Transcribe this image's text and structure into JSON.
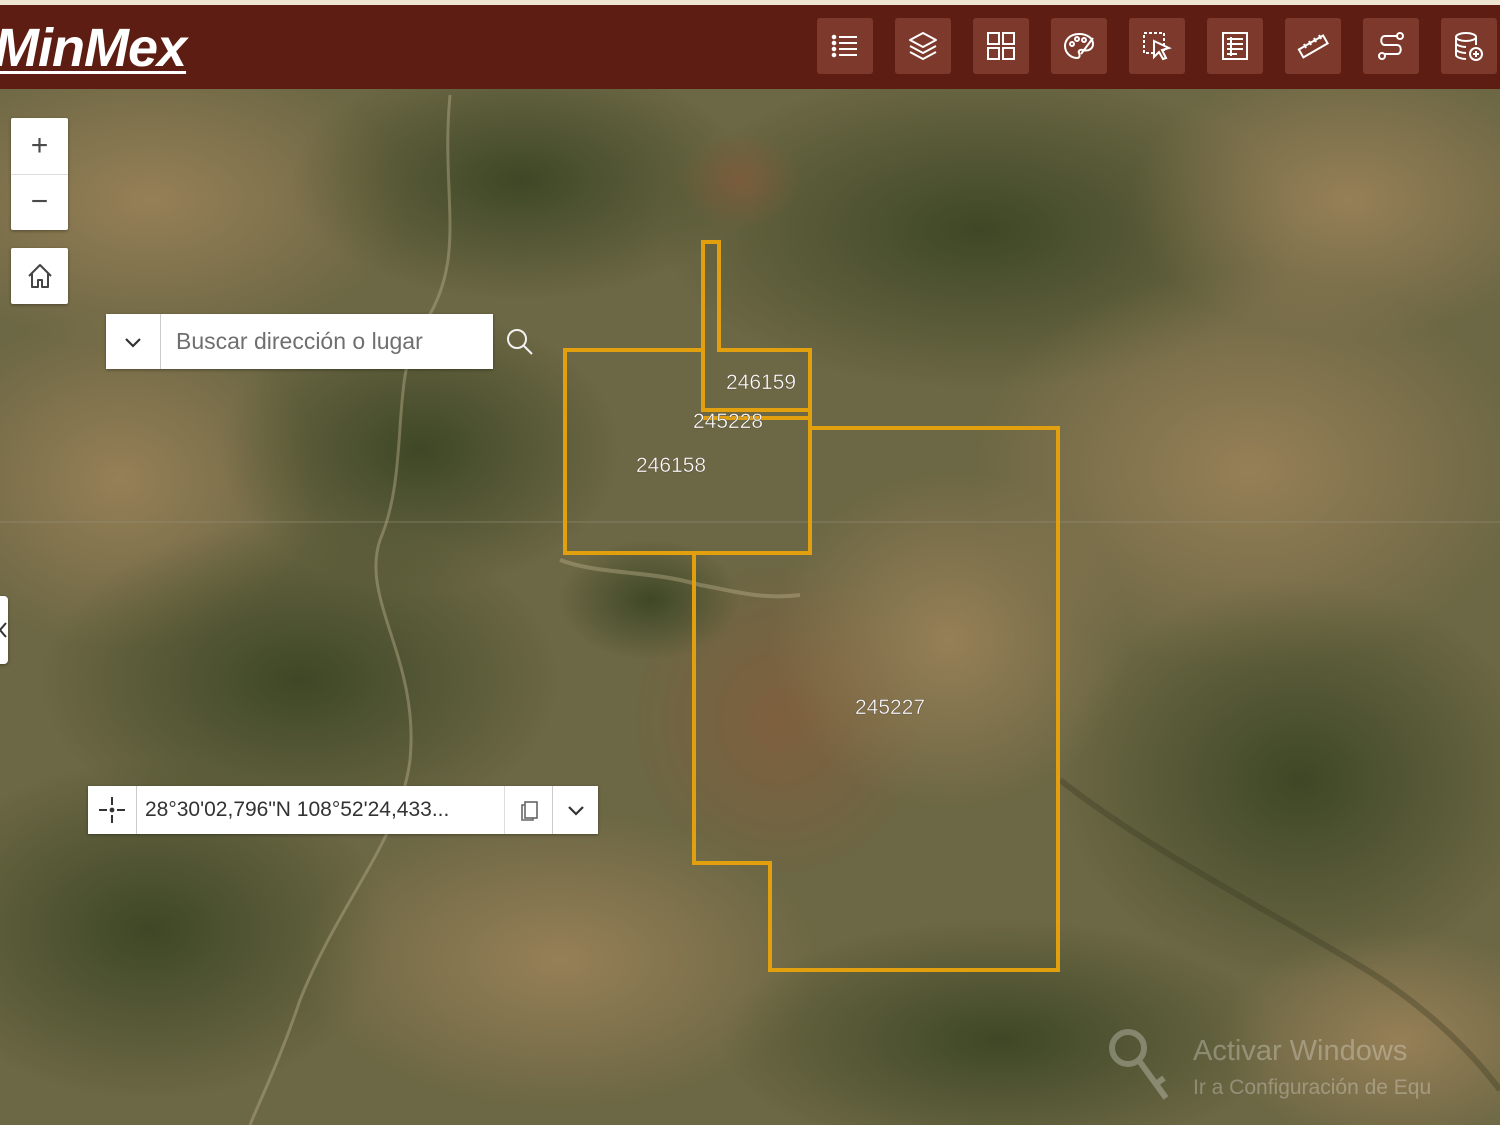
{
  "app": {
    "title": "MinMex"
  },
  "colors": {
    "header": "#5e1d12",
    "button": "#7d3a2c",
    "claim_outline": "#e2a00e"
  },
  "toolbar": [
    {
      "icon": "list-icon"
    },
    {
      "icon": "layers-icon"
    },
    {
      "icon": "grid-icon"
    },
    {
      "icon": "palette-icon"
    },
    {
      "icon": "select-icon"
    },
    {
      "icon": "table-icon"
    },
    {
      "icon": "measure-icon"
    },
    {
      "icon": "route-icon"
    },
    {
      "icon": "database-icon"
    }
  ],
  "zoom": {
    "in_label": "+",
    "out_label": "−"
  },
  "search": {
    "placeholder": "Buscar dirección o lugar"
  },
  "coordinates": {
    "value": "28°30'02,796\"N 108°52'24,433..."
  },
  "claims": [
    {
      "id": "246159"
    },
    {
      "id": "245228"
    },
    {
      "id": "246158"
    },
    {
      "id": "245227"
    }
  ],
  "watermark": {
    "title": "Activar Windows",
    "subtitle": "Ir a Configuración de Equ"
  }
}
